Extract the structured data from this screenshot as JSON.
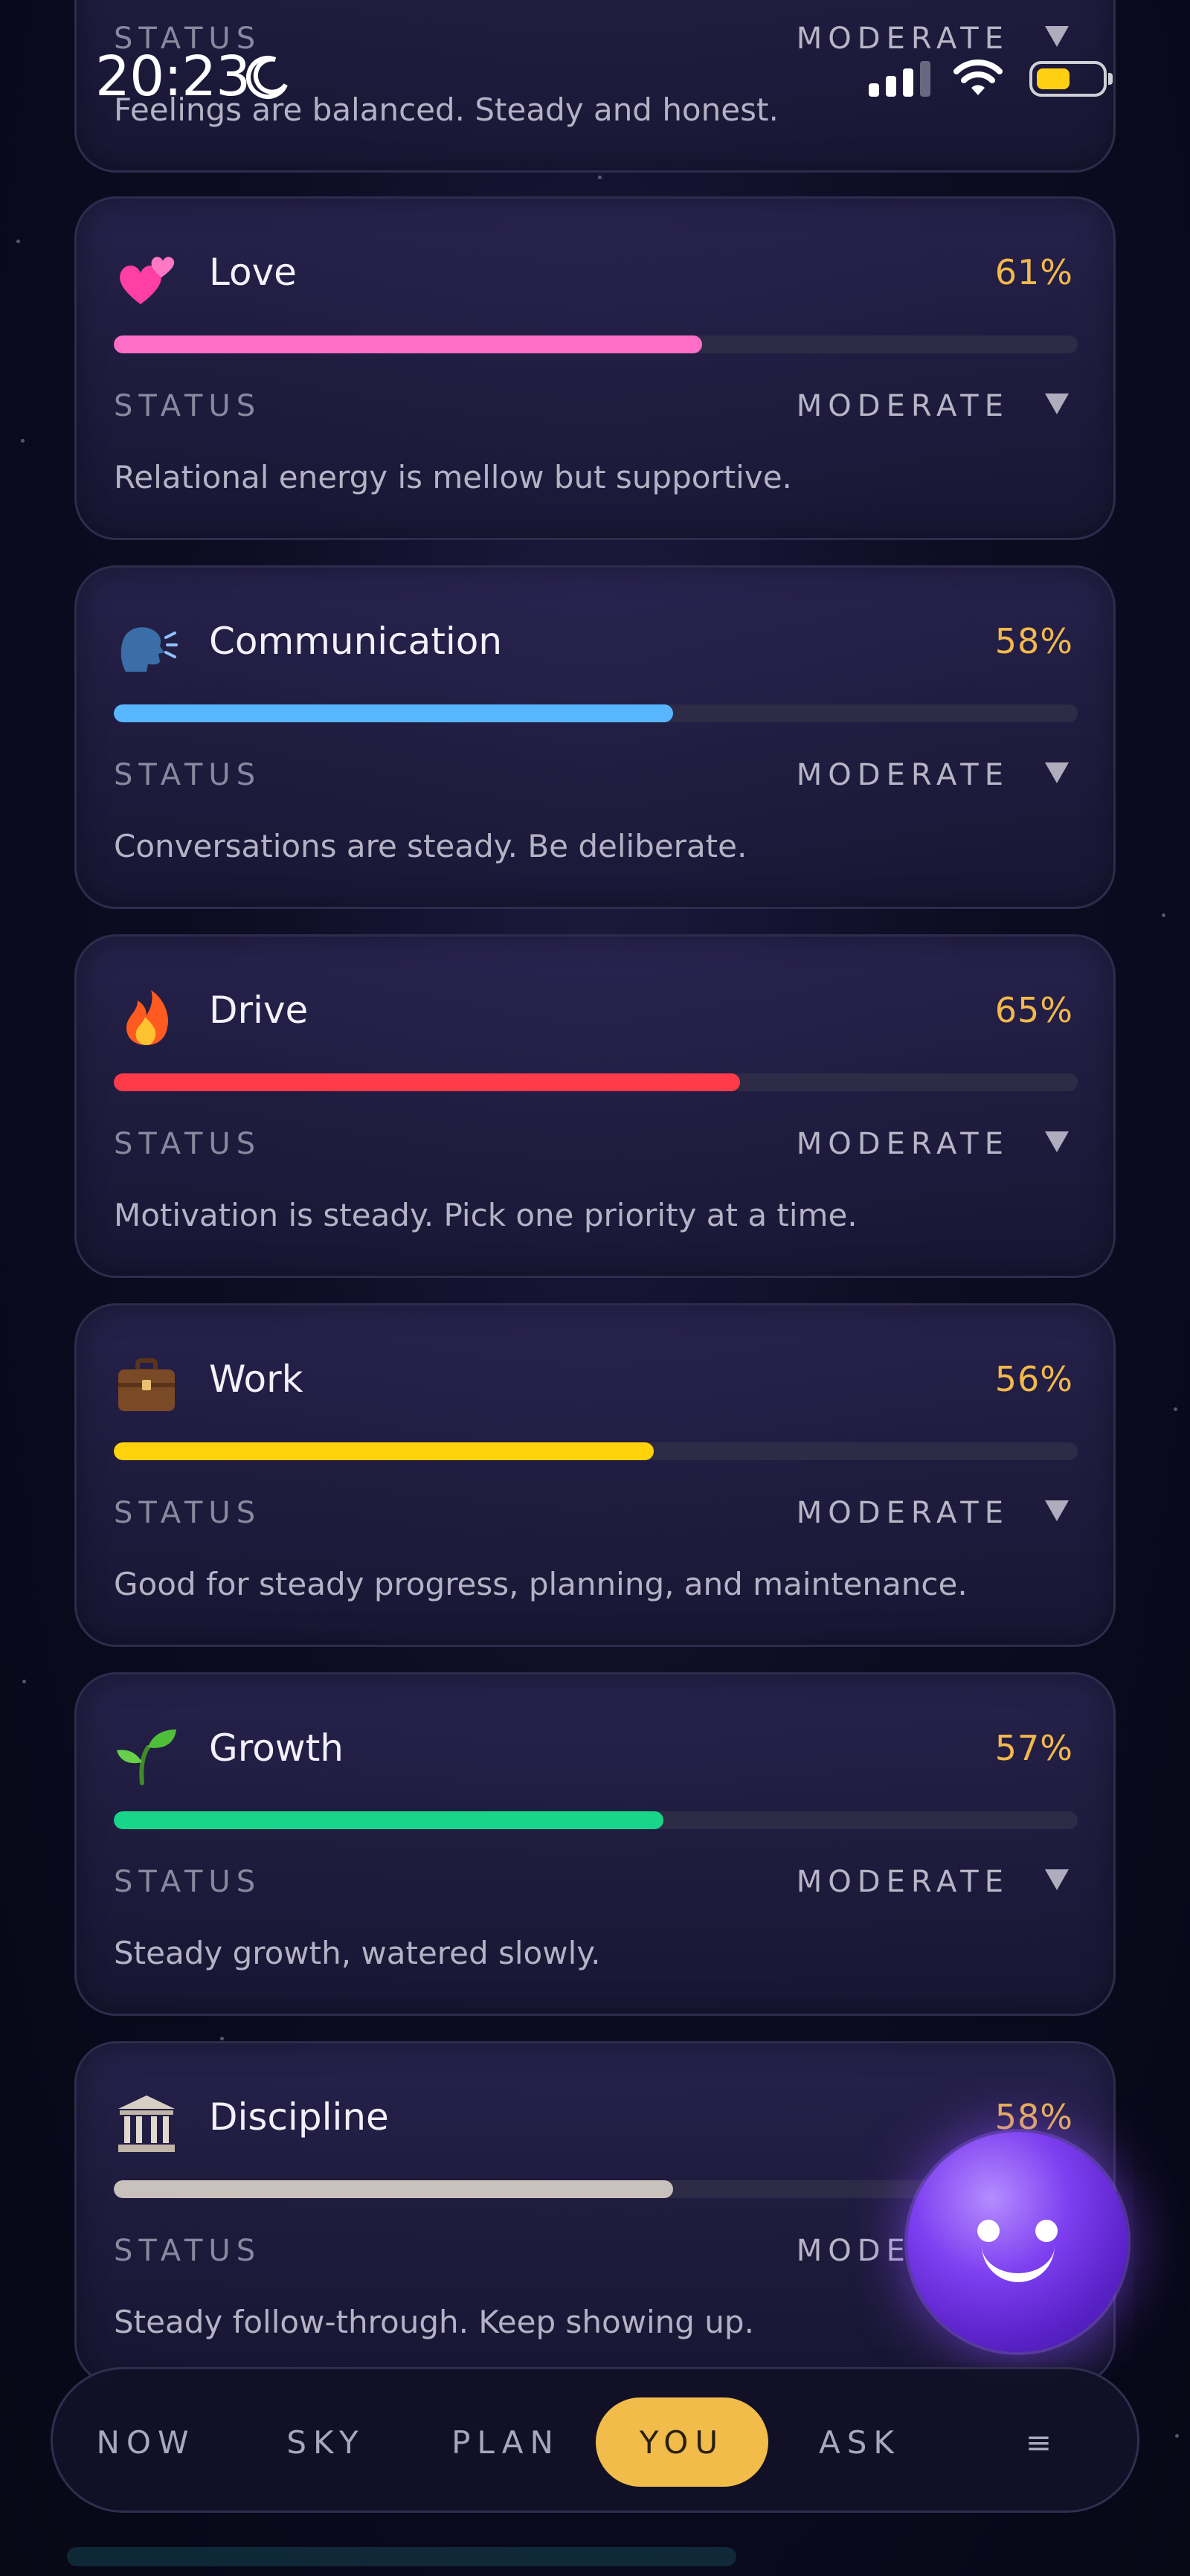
{
  "status_bar": {
    "time": "20:23"
  },
  "top_card": {
    "status_label": "STATUS",
    "status_value": "MODERATE",
    "description": "Feelings are balanced. Steady and honest."
  },
  "cards": [
    {
      "icon": "two-hearts-icon",
      "title": "Love",
      "percent": "61%",
      "value": 0.61,
      "color": "#ff6ec7",
      "status_label": "STATUS",
      "status_value": "MODERATE",
      "description": "Relational energy is mellow but supportive."
    },
    {
      "icon": "speaking-head-icon",
      "title": "Communication",
      "percent": "58%",
      "value": 0.58,
      "color": "#58b6ff",
      "status_label": "STATUS",
      "status_value": "MODERATE",
      "description": "Conversations are steady. Be deliberate."
    },
    {
      "icon": "fire-icon",
      "title": "Drive",
      "percent": "65%",
      "value": 0.65,
      "color": "#ff3b4a",
      "status_label": "STATUS",
      "status_value": "MODERATE",
      "description": "Motivation is steady. Pick one priority at a time."
    },
    {
      "icon": "briefcase-icon",
      "title": "Work",
      "percent": "56%",
      "value": 0.56,
      "color": "#ffd20a",
      "status_label": "STATUS",
      "status_value": "MODERATE",
      "description": "Good for steady progress, planning, and maintenance."
    },
    {
      "icon": "seedling-icon",
      "title": "Growth",
      "percent": "57%",
      "value": 0.57,
      "color": "#18d58a",
      "status_label": "STATUS",
      "status_value": "MODERATE",
      "description": "Steady growth, watered slowly."
    },
    {
      "icon": "classical-building-icon",
      "title": "Discipline",
      "percent": "58%",
      "value": 0.58,
      "color": "#c9c1bb",
      "status_label": "STATUS",
      "status_value": "MODERATE",
      "description": "Steady follow-through. Keep showing up."
    }
  ],
  "nav": {
    "items": [
      "NOW",
      "SKY",
      "PLAN",
      "YOU",
      "ASK",
      "≡"
    ],
    "active": "YOU"
  }
}
